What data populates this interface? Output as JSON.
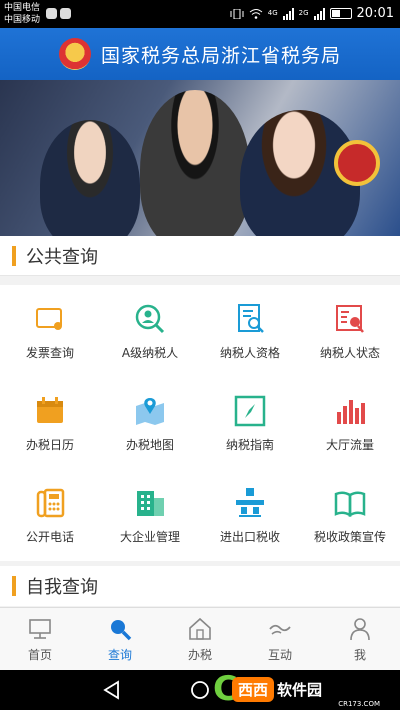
{
  "status_bar": {
    "carrier_1": "中国电信",
    "carrier_2": "中国移动",
    "network_1": "4G",
    "network_2": "2G",
    "time": "20:01"
  },
  "header": {
    "title": "国家税务总局浙江省税务局"
  },
  "public_query": {
    "title": "公共查询",
    "items": [
      {
        "label": "发票查询",
        "icon": "invoice-search-icon",
        "color": "#f0a020"
      },
      {
        "label": "A级纳税人",
        "icon": "a-level-taxpayer-icon",
        "color": "#28b28c"
      },
      {
        "label": "纳税人资格",
        "icon": "taxpayer-qualification-icon",
        "color": "#1a9bd6"
      },
      {
        "label": "纳税人状态",
        "icon": "taxpayer-status-icon",
        "color": "#e24a4a"
      },
      {
        "label": "办税日历",
        "icon": "tax-calendar-icon",
        "color": "#f0a020"
      },
      {
        "label": "办税地图",
        "icon": "tax-map-icon",
        "color": "#1a9bd6"
      },
      {
        "label": "纳税指南",
        "icon": "tax-guide-icon",
        "color": "#28b28c"
      },
      {
        "label": "大厅流量",
        "icon": "hall-traffic-icon",
        "color": "#e24a4a"
      },
      {
        "label": "公开电话",
        "icon": "public-phone-icon",
        "color": "#f0a020"
      },
      {
        "label": "大企业管理",
        "icon": "enterprise-management-icon",
        "color": "#28b28c"
      },
      {
        "label": "进出口税收",
        "icon": "import-export-tax-icon",
        "color": "#1a9bd6"
      },
      {
        "label": "税收政策宣传",
        "icon": "tax-policy-book-icon",
        "color": "#28b28c"
      }
    ]
  },
  "self_query": {
    "title": "自我查询"
  },
  "tabbar": {
    "active_color": "#1a78d6",
    "tabs": [
      {
        "label": "首页",
        "icon": "home-monitor-icon"
      },
      {
        "label": "查询",
        "icon": "search-icon"
      },
      {
        "label": "办税",
        "icon": "tax-house-icon"
      },
      {
        "label": "互动",
        "icon": "interaction-icon"
      },
      {
        "label": "我",
        "icon": "user-icon"
      }
    ]
  },
  "watermark": {
    "brand_box": "西西",
    "brand_text": "软件园",
    "site": "CR173.COM"
  }
}
